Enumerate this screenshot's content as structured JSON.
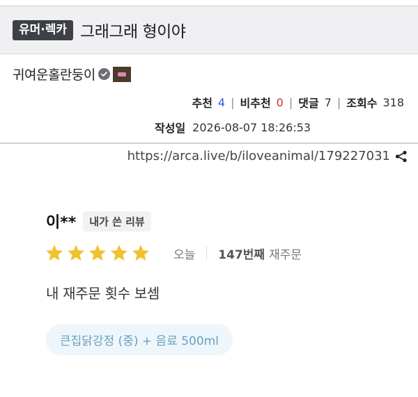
{
  "post": {
    "category": "유머·렉카",
    "title": "그래그래 형이야"
  },
  "author": {
    "name": "귀여운홀란둥이",
    "verified_icon": "verified-check-icon",
    "emblem_icon": "user-emblem-icon"
  },
  "stats": {
    "likes_label": "추천",
    "likes_value": "4",
    "dislikes_label": "비추천",
    "dislikes_value": "0",
    "comments_label": "댓글",
    "comments_value": "7",
    "views_label": "조회수",
    "views_value": "318",
    "separator": "|",
    "likes_color": "#2d5bd6",
    "dislikes_color": "#d12f2f"
  },
  "date": {
    "label": "작성일",
    "value": "2026-08-07 18:26:53"
  },
  "url": {
    "text": "https://arca.live/b/iloveanimal/179227031",
    "share_icon": "share-icon"
  },
  "review": {
    "reviewer": "이**",
    "mine_label": "내가 쓴 리뷰",
    "rating": 5,
    "rating_max": 5,
    "star_color": "#f2c12e",
    "date": "오늘",
    "order_count": "147번째",
    "order_suffix": "재주문",
    "text": "내 재주문 횟수 보셈",
    "menu": "큰집닭강정 (중) + 음료 500ml"
  }
}
